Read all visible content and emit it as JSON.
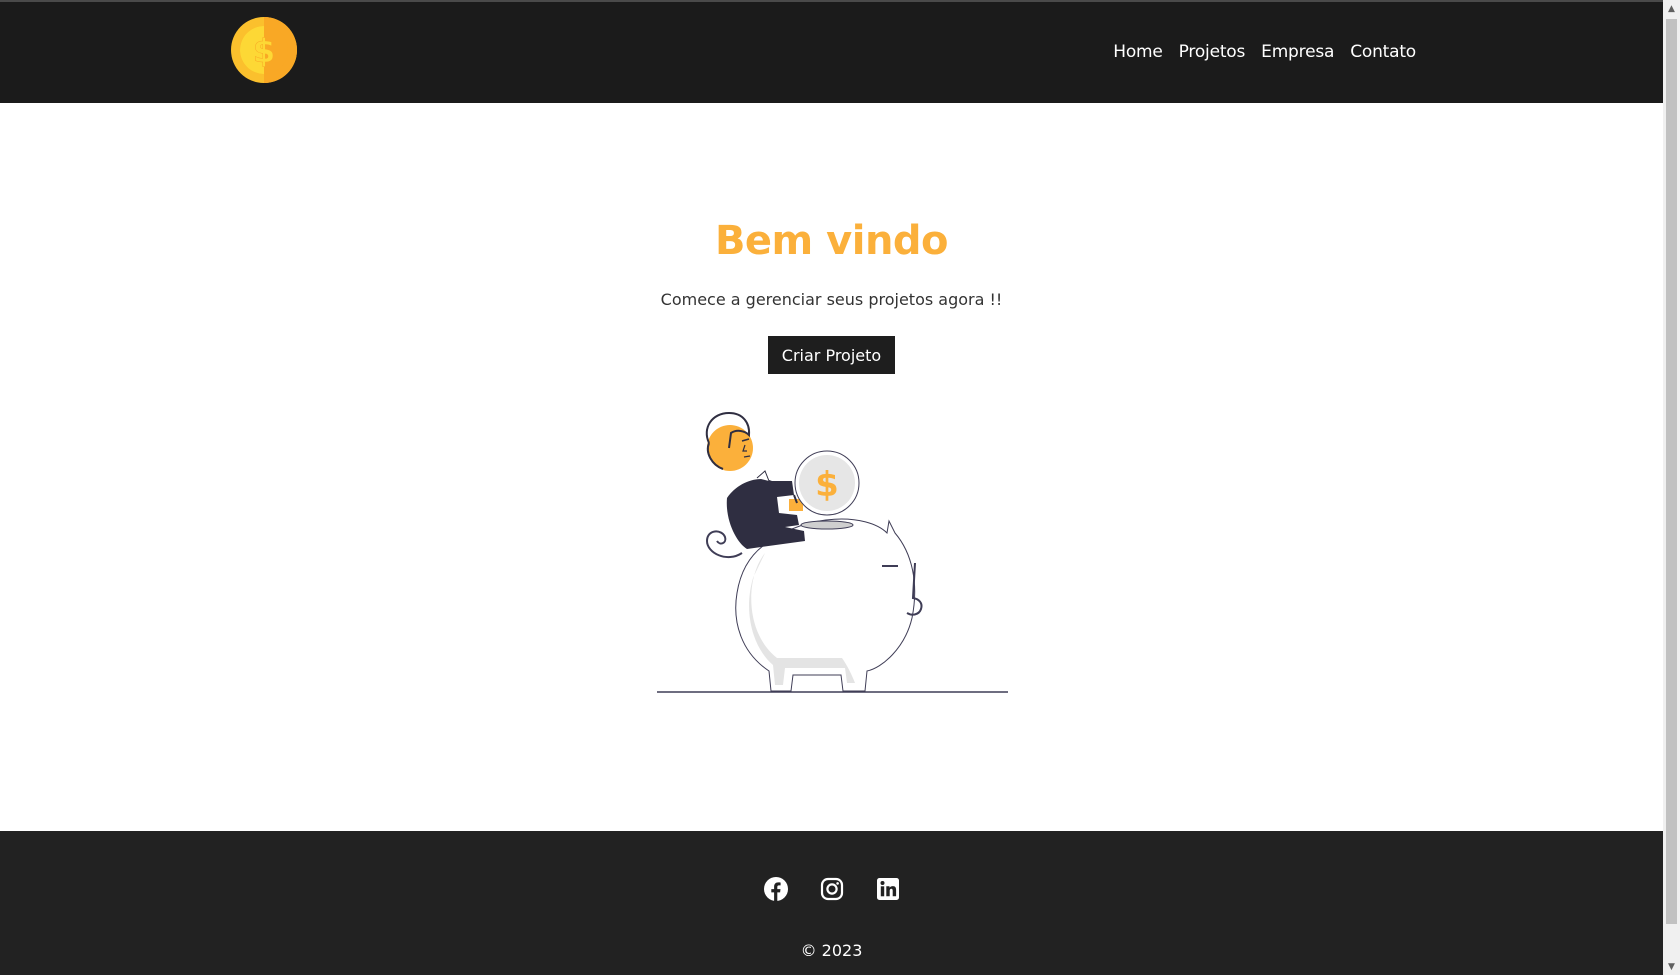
{
  "nav": {
    "logo_icon": "dollar-coin-logo",
    "links": [
      {
        "label": "Home"
      },
      {
        "label": "Projetos"
      },
      {
        "label": "Empresa"
      },
      {
        "label": "Contato"
      }
    ]
  },
  "hero": {
    "title": "Bem vindo",
    "subtitle": "Comece a gerenciar seus projetos agora !!",
    "cta_label": "Criar Projeto",
    "illustration": "person-with-coin-on-piggy-bank"
  },
  "footer": {
    "social": [
      {
        "icon": "facebook-icon"
      },
      {
        "icon": "instagram-icon"
      },
      {
        "icon": "linkedin-icon"
      }
    ],
    "copyright": "© 2023"
  },
  "colors": {
    "accent": "#fbb03b",
    "navbar_bg": "#1b1b1b",
    "footer_bg": "#222222",
    "button_bg": "#1e1e1e"
  }
}
